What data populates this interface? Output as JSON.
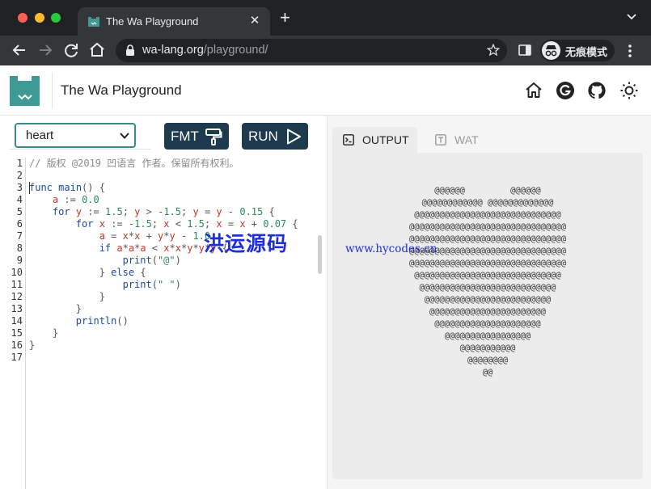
{
  "browser": {
    "tab_title": "The Wa Playground",
    "tab_close": "✕",
    "new_tab": "+",
    "tab_menu": "⌄",
    "url_host": "wa-lang.org",
    "url_path": "/playground/",
    "incognito_label": "无痕模式"
  },
  "header": {
    "title": "The Wa Playground"
  },
  "editor": {
    "example_selected": "heart",
    "fmt_label": "FMT",
    "run_label": "RUN",
    "line_numbers": [
      "1",
      "2",
      "3",
      "4",
      "5",
      "6",
      "7",
      "8",
      "9",
      "10",
      "11",
      "12",
      "13",
      "14",
      "15",
      "16",
      "17"
    ],
    "lines": [
      "// 版权 @2019 凹语言 作者。保留所有权利。",
      "",
      "func main() {",
      "    a := 0.0",
      "    for y := 1.5; y > -1.5; y = y - 0.15 {",
      "        for x := -1.5; x < 1.5; x = x + 0.07 {",
      "            a = x*x + y*y - 1.0",
      "            if a*a*a < x*x*y*y*y {",
      "                print(\"@\")",
      "            } else {",
      "                print(\" \")",
      "            }",
      "        }",
      "        println()",
      "    }",
      "}",
      ""
    ]
  },
  "watermark": {
    "text": "洪运源码",
    "url": "www.hycodes.cn"
  },
  "output": {
    "tab_output_label": "OUTPUT",
    "tab_wat_label": "WAT",
    "text": "      @@@@@@         @@@@@@      \n   @@@@@@@@@@@@ @@@@@@@@@@@@@   \n  @@@@@@@@@@@@@@@@@@@@@@@@@@@@@  \n @@@@@@@@@@@@@@@@@@@@@@@@@@@@@@@ \n @@@@@@@@@@@@@@@@@@@@@@@@@@@@@@@ \n @@@@@@@@@@@@@@@@@@@@@@@@@@@@@@@ \n @@@@@@@@@@@@@@@@@@@@@@@@@@@@@@@ \n  @@@@@@@@@@@@@@@@@@@@@@@@@@@@@  \n   @@@@@@@@@@@@@@@@@@@@@@@@@@@   \n    @@@@@@@@@@@@@@@@@@@@@@@@@    \n     @@@@@@@@@@@@@@@@@@@@@@@     \n      @@@@@@@@@@@@@@@@@@@@@      \n        @@@@@@@@@@@@@@@@@        \n           @@@@@@@@@@@           \n              @@@@@@@@              \n                 @@                 "
  },
  "colors": {
    "brand_teal": "#3d9a95",
    "button_navy": "#1e3a4f",
    "keyword_blue": "#1b4aa5",
    "variable_red": "#c0392b",
    "number_green": "#2e8b57",
    "watermark_blue": "#1f2fd8"
  },
  "icons": {
    "home": "home-icon",
    "g": "g-icon",
    "github": "github-icon",
    "theme": "sun-icon"
  }
}
